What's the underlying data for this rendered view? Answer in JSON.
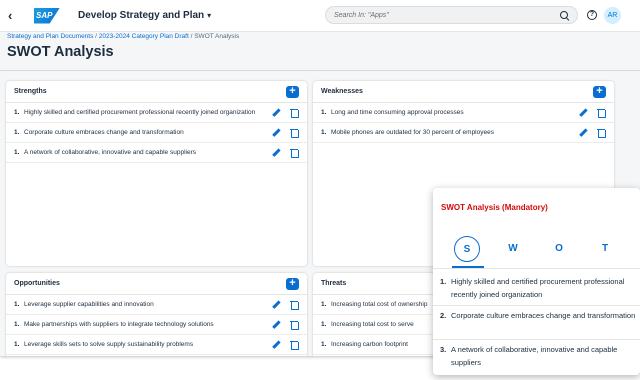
{
  "shell": {
    "logo": "SAP",
    "app_title": "Develop Strategy and Plan",
    "search_placeholder": "Search In: \"Apps\"",
    "help": "?",
    "avatar": "AR"
  },
  "breadcrumb": {
    "items": [
      "Strategy and Plan Documents",
      "2023-2024 Category Plan Draft"
    ],
    "current": "SWOT Analysis"
  },
  "page_title": "SWOT Analysis",
  "add_label": "+",
  "panels": {
    "strengths": {
      "title": "Strengths",
      "items": [
        {
          "num": "1.",
          "text": "Highly skilled and certified procurement professional recently joined organization"
        },
        {
          "num": "1.",
          "text": "Corporate culture embraces change and transformation"
        },
        {
          "num": "1.",
          "text": "A network of collaborative, innovative and capable suppliers"
        }
      ]
    },
    "weaknesses": {
      "title": "Weaknesses",
      "items": [
        {
          "num": "1.",
          "text": "Long and time consuming approval processes"
        },
        {
          "num": "1.",
          "text": "Mobile phones are outdated for 30 percent of employees"
        }
      ]
    },
    "opportunities": {
      "title": "Opportunities",
      "items": [
        {
          "num": "1.",
          "text": "Leverage supplier capabilities and innovation"
        },
        {
          "num": "1.",
          "text": "Make partnerships with suppliers to integrate technology solutions"
        },
        {
          "num": "1.",
          "text": "Leverage skills sets to solve supply sustainability problems"
        }
      ]
    },
    "threats": {
      "title": "Threats",
      "items": [
        {
          "num": "1.",
          "text": "Increasing total cost of ownership"
        },
        {
          "num": "1.",
          "text": "Increasing total cost to serve"
        },
        {
          "num": "1.",
          "text": "Increasing carbon footprint"
        }
      ]
    }
  },
  "popover": {
    "title": "SWOT Analysis (Mandatory)",
    "tabs": [
      "S",
      "W",
      "O",
      "T"
    ],
    "active_tab": "S",
    "items": [
      {
        "num": "1.",
        "text": "Highly skilled and certified procurement professional recently joined organization"
      },
      {
        "num": "2.",
        "text": "Corporate culture embraces change and transformation"
      },
      {
        "num": "3.",
        "text": "A network of collaborative, innovative and capable suppliers"
      }
    ]
  },
  "colors": {
    "accent": "#0a6ed1",
    "mandatory_title": "#d20a0a",
    "background": "#f5f6f7"
  },
  "icons": [
    "back-icon",
    "sap-logo",
    "chevron-down-icon",
    "search-icon",
    "help-icon",
    "add-icon",
    "edit-icon",
    "delete-icon"
  ]
}
